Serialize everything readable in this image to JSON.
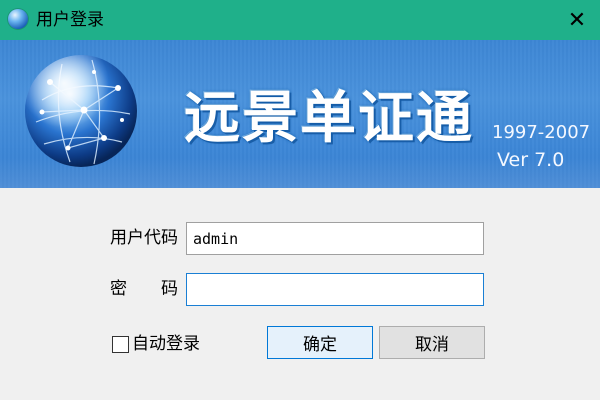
{
  "window": {
    "title": "用户登录",
    "close_glyph": "✕",
    "title_icon": "globe-icon",
    "titlebar_color": "#1fb08a"
  },
  "banner": {
    "product_name": "远景单证通",
    "years": "1997-2007",
    "version": "Ver 7.0",
    "logo": "globe-network-logo",
    "background_color": "#4a92dc"
  },
  "form": {
    "user_code_label": "用户代码",
    "user_code_value": "admin",
    "password_label_1": "密",
    "password_label_2": "码",
    "password_value": "",
    "auto_login_label": "自动登录",
    "auto_login_checked": false
  },
  "buttons": {
    "ok_label": "确定",
    "cancel_label": "取消"
  }
}
